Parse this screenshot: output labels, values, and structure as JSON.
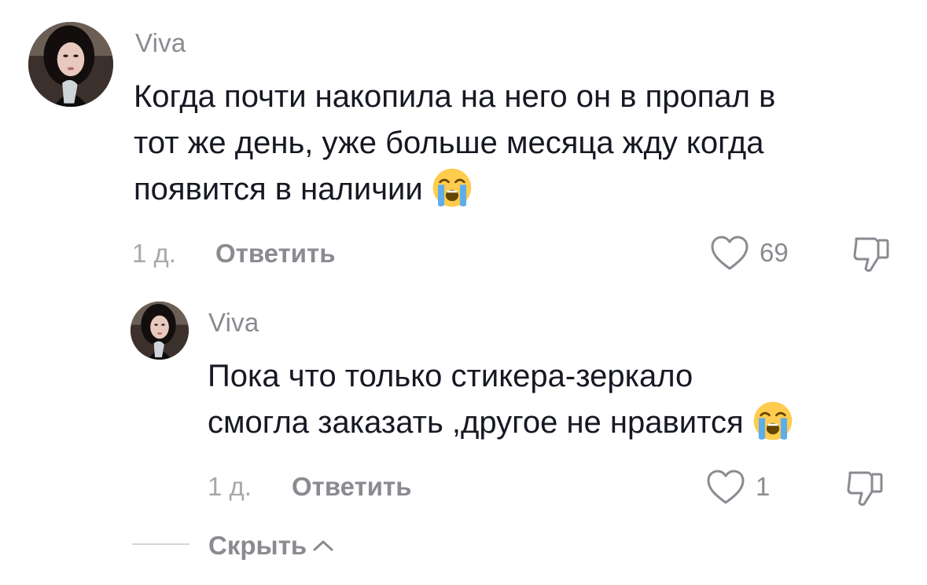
{
  "comment": {
    "username": "Viva",
    "text_lines": [
      "Когда почти накопила на него он в пропал в",
      "тот же день, уже больше месяца жду когда",
      "появится в наличии"
    ],
    "time": "1 д.",
    "reply_label": "Ответить",
    "likes": "69",
    "emoji": "loudly-crying-face"
  },
  "reply": {
    "username": "Viva",
    "text_lines": [
      "Пока что только стикера-зеркало",
      "смогла заказать ,другое не нравится"
    ],
    "time": "1 д.",
    "reply_label": "Ответить",
    "likes": "1",
    "emoji": "loudly-crying-face"
  },
  "thread": {
    "hide_label": "Скрыть"
  },
  "colors": {
    "text": "#161823",
    "secondary": "#8a8b91",
    "time": "#a7a8ad"
  }
}
